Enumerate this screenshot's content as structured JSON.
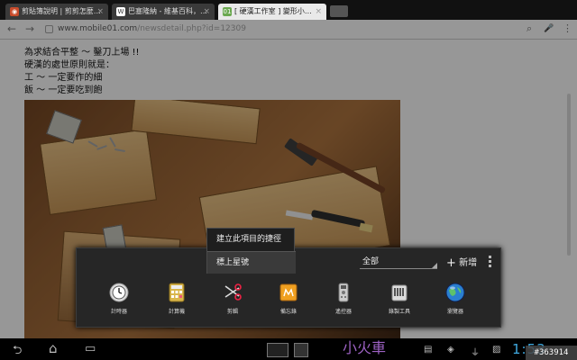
{
  "tabs": [
    {
      "label": "剪貼簿說明 | 剪剪怎麼畫家",
      "favicon_color": "#c84b2b",
      "favicon_glyph": "◉"
    },
    {
      "label": "巴塞隆納 - 維基百科，自由",
      "favicon_color": "#ffffff",
      "favicon_glyph": "W"
    },
    {
      "label": "[ 硬漢工作室 ] 變形小火車",
      "favicon_color": "#6aa84f",
      "favicon_glyph": "01"
    }
  ],
  "tab_close_icon": "×",
  "url": {
    "host": "www.mobile01.com",
    "path": "/newsdetail.php?id=12309"
  },
  "toolbar_icons": {
    "back": "←",
    "forward": "→",
    "search": "⌕",
    "mic": "🎤",
    "menu": "⋮"
  },
  "content": {
    "lines": [
      "為求結合平整 ～ 鑿刀上場 !!",
      "硬漢的處世原則就是：",
      "工 ～ 一定要作的細",
      "飯 ～ 一定要吃到飽"
    ]
  },
  "context_menu": {
    "items": [
      "建立此項目的捷徑",
      "標上星號"
    ]
  },
  "panel": {
    "category": "全部",
    "add_label": "新增",
    "add_icon": "+",
    "apps": [
      {
        "label": "計時器",
        "icon": "timer-icon"
      },
      {
        "label": "計算機",
        "icon": "calculator-icon"
      },
      {
        "label": "剪輯",
        "icon": "scissors-icon"
      },
      {
        "label": "備忘錄",
        "icon": "memo-icon"
      },
      {
        "label": "遙控器",
        "icon": "remote-control-icon"
      },
      {
        "label": "錄製工具",
        "icon": "recorder-icon"
      },
      {
        "label": "瀏覽器",
        "icon": "browser-globe-icon"
      }
    ]
  },
  "sysbar": {
    "back": "⮌",
    "home": "⌂",
    "recent": "▭",
    "purple_text": "小火車",
    "clock": "1:53",
    "id_tag": "#363914"
  }
}
